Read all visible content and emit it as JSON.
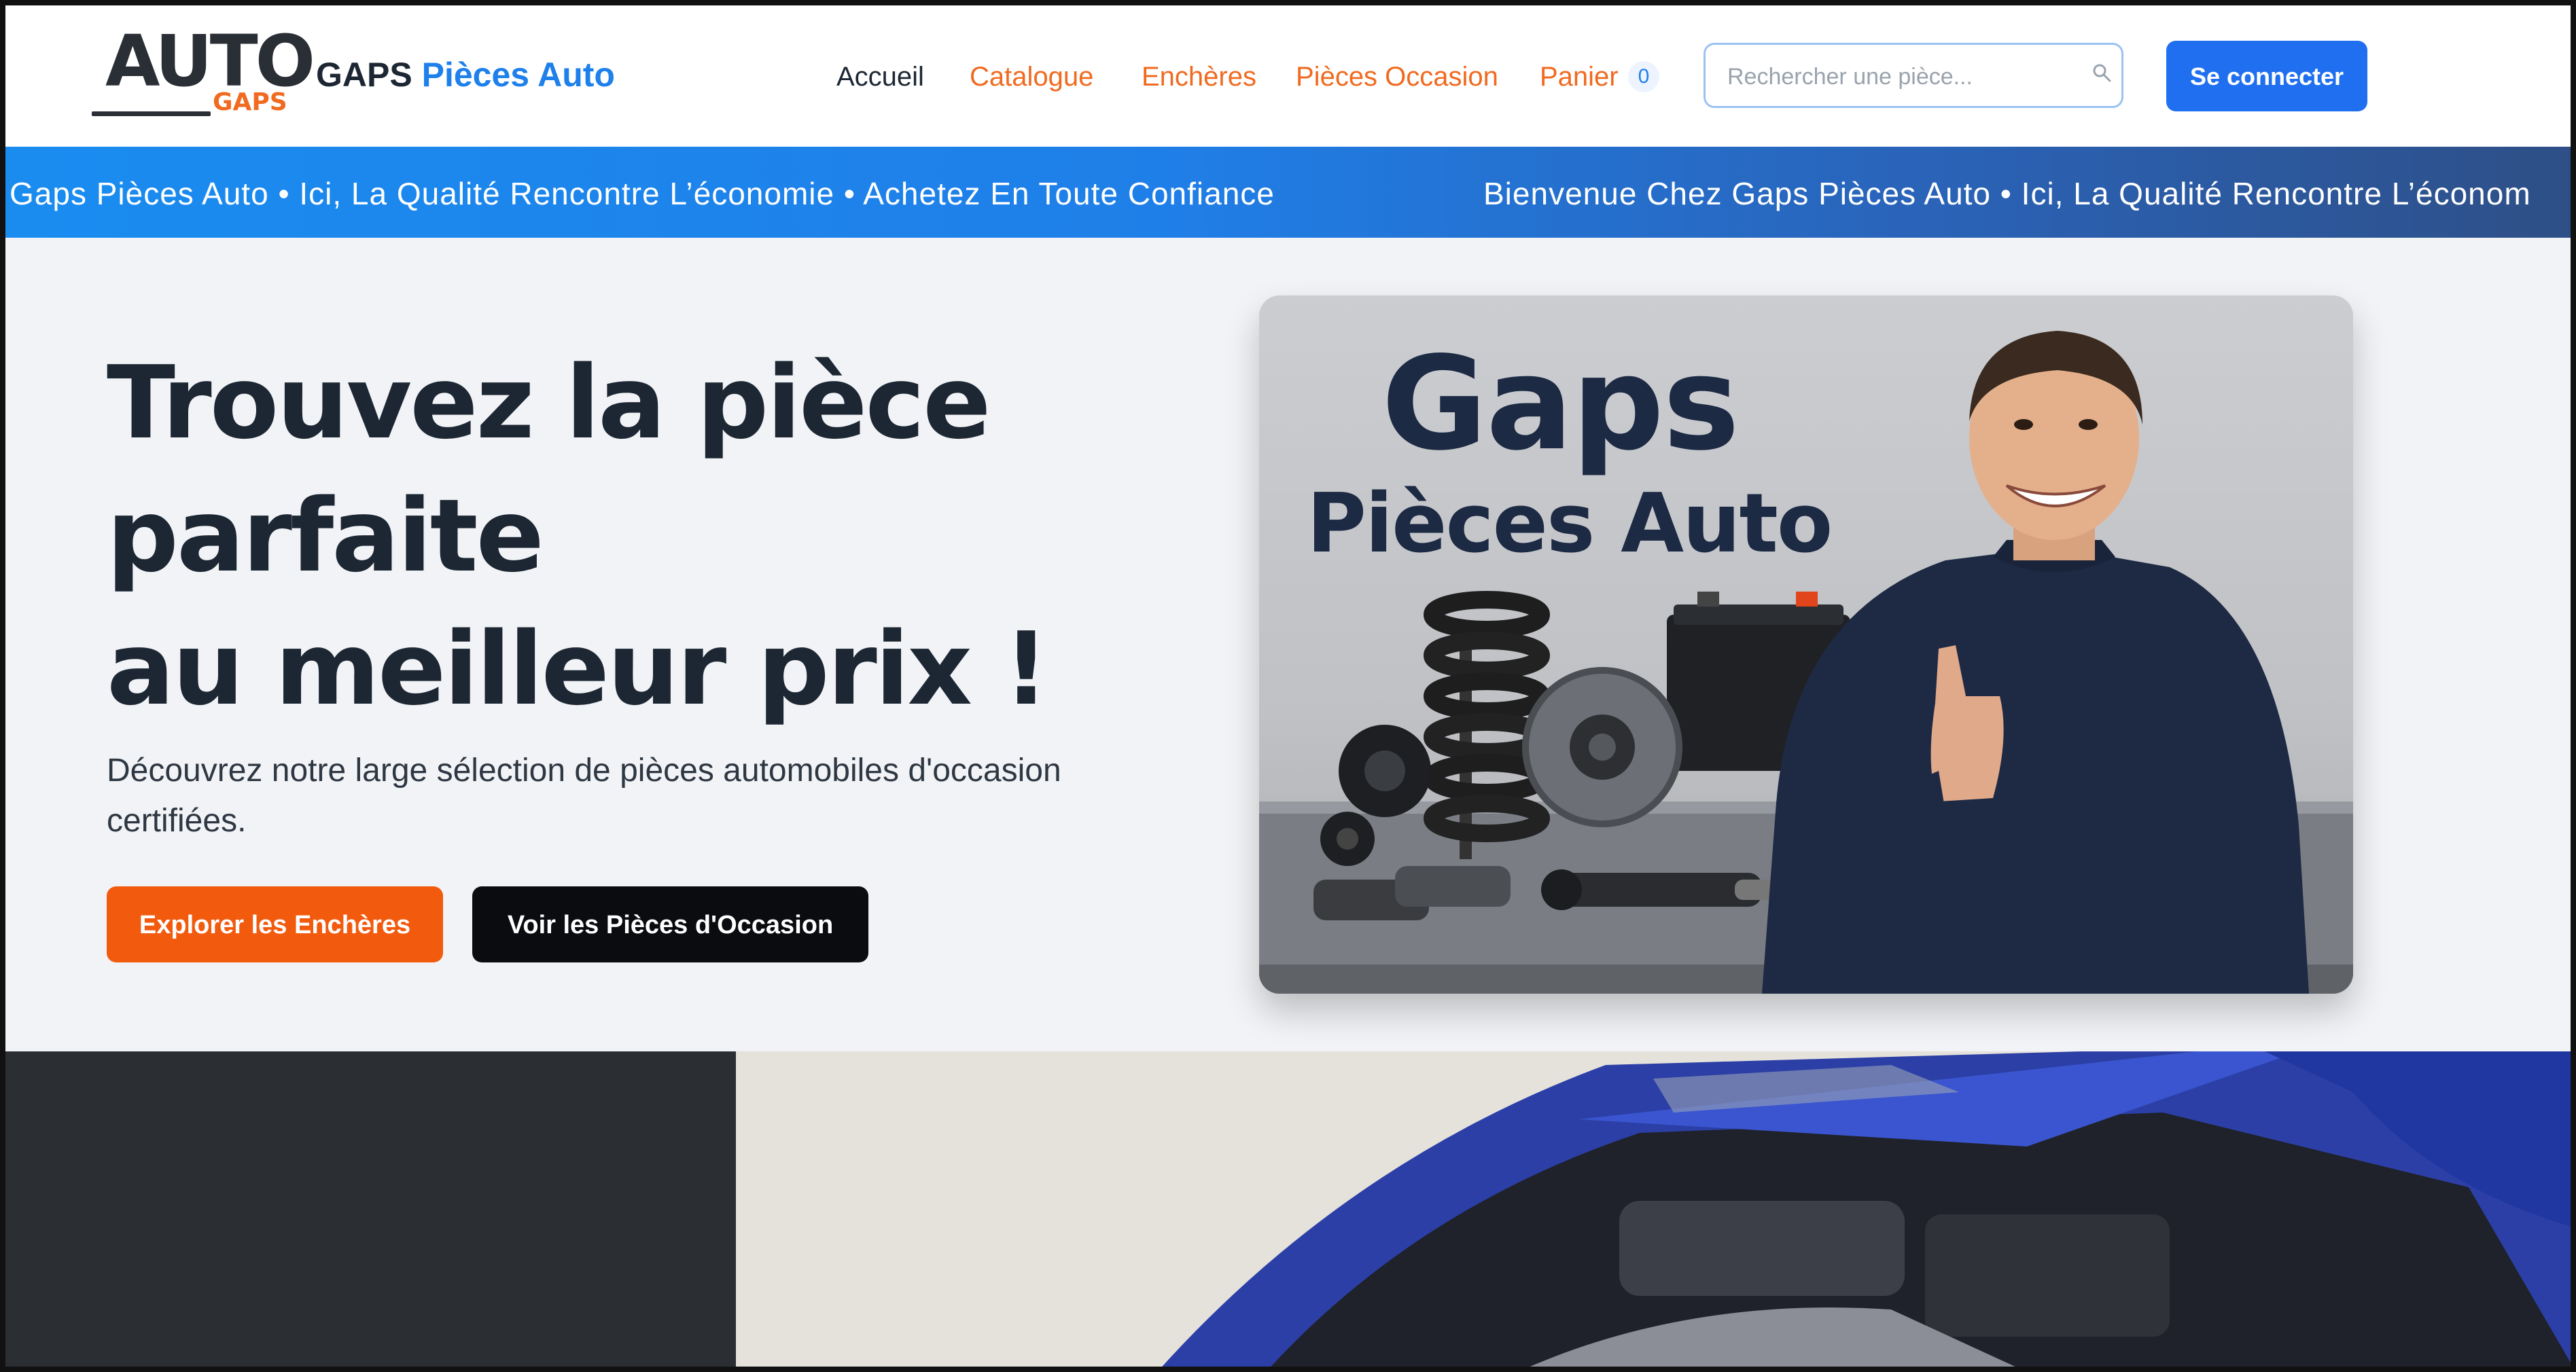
{
  "header": {
    "logo": {
      "text": "AUTO",
      "subtext": "GAPS"
    },
    "brand": {
      "part1": "GAPS",
      "part2": "Pièces Auto"
    },
    "nav": [
      {
        "label": "Accueil"
      },
      {
        "label": "Catalogue"
      },
      {
        "label": "Enchères"
      },
      {
        "label": "Pièces Occasion"
      },
      {
        "label": "Panier"
      }
    ],
    "cart_count": "0",
    "search": {
      "placeholder": "Rechercher une pièce...",
      "icon": "search-icon"
    },
    "login_label": "Se connecter"
  },
  "banner": {
    "segment1": "Gaps Pièces Auto • Ici, La Qualité Rencontre L’économie • Achetez En Toute Confiance",
    "segment2": "Bienvenue Chez Gaps Pièces Auto • Ici, La Qualité Rencontre L’économ"
  },
  "hero": {
    "title_lines": [
      "Trouvez la pièce",
      "parfaite",
      "au meilleur prix !"
    ],
    "subtitle": "Découvrez notre large sélection de pièces automobiles d'occasion certifiées.",
    "primary_button": "Explorer les Enchères",
    "secondary_button": "Voir les Pièces d'Occasion",
    "image": {
      "title": "Gaps",
      "subtitle": "Pièces Auto"
    }
  },
  "colors": {
    "accent_orange": "#f25a0e",
    "brand_blue": "#1e80ea",
    "button_blue": "#1f6ff0",
    "dark_text": "#1d2733"
  }
}
